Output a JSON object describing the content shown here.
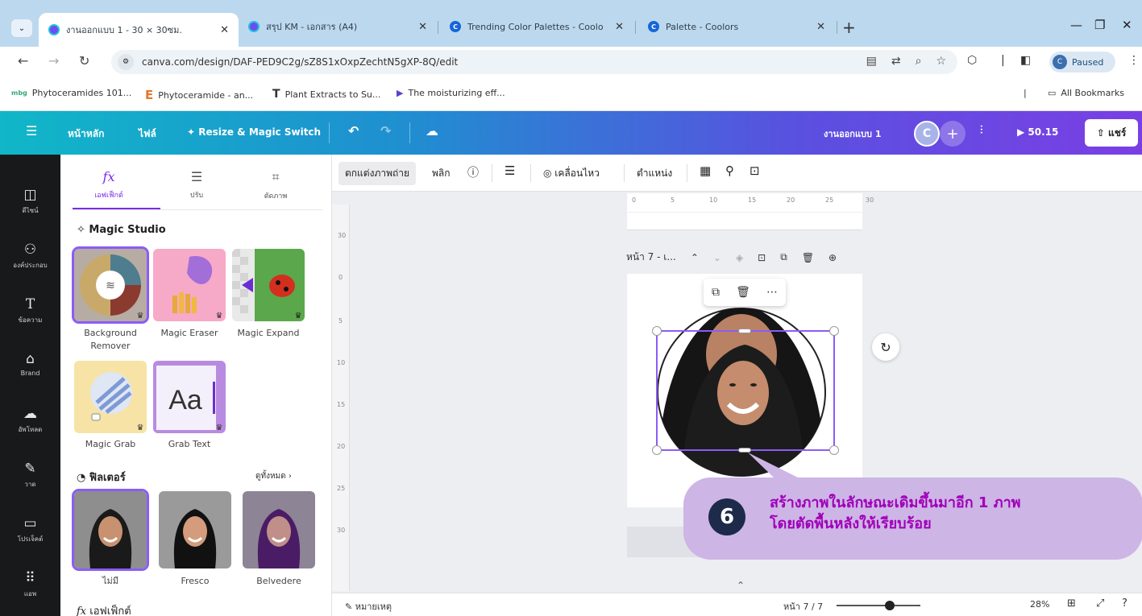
{
  "browser": {
    "tabs": [
      {
        "title": "งานออกแบบ 1 - 30 × 30ซม.",
        "active": true
      },
      {
        "title": "สรุป KM - เอกสาร (A4)",
        "active": false
      },
      {
        "title": "Trending Color Palettes - Coolo",
        "active": false
      },
      {
        "title": "Palette - Coolors",
        "active": false
      }
    ],
    "url": "canva.com/design/DAF-PED9C2g/sZ8S1xOxpZechtN5gXP-8Q/edit",
    "profile_status": "Paused",
    "bookmarks": [
      "Phytoceramides 101...",
      "Phytoceramide - an...",
      "Plant Extracts to Su...",
      "The moisturizing eff..."
    ],
    "all_bookmarks": "All Bookmarks"
  },
  "canva_header": {
    "home": "หน้าหลัก",
    "file": "ไฟล์",
    "resize": "Resize & Magic Switch",
    "doc_title": "งานออกแบบ 1",
    "user_initial": "C",
    "present_time": "50.15",
    "share": "แชร์"
  },
  "rail": [
    {
      "icon": "template-icon",
      "label": "ดีไซน์"
    },
    {
      "icon": "elements-icon",
      "label": "องค์ประกอบ"
    },
    {
      "icon": "text-icon",
      "label": "ข้อความ"
    },
    {
      "icon": "brand-icon",
      "label": "Brand"
    },
    {
      "icon": "upload-icon",
      "label": "อัพโหลด"
    },
    {
      "icon": "draw-icon",
      "label": "วาด"
    },
    {
      "icon": "projects-icon",
      "label": "โปรเจ็คต์"
    },
    {
      "icon": "apps-icon",
      "label": "แอพ"
    }
  ],
  "panel": {
    "tabs": [
      {
        "label": "เอฟเฟ็กต์",
        "icon": "fx"
      },
      {
        "label": "ปรับ",
        "icon": "adjust-icon"
      },
      {
        "label": "ตัดภาพ",
        "icon": "crop-icon"
      }
    ],
    "magic_studio_title": "Magic Studio",
    "magic_tools": [
      {
        "label": "Background Remover"
      },
      {
        "label": "Magic Eraser"
      },
      {
        "label": "Magic Expand"
      },
      {
        "label": "Magic Grab"
      },
      {
        "label": "Grab Text"
      }
    ],
    "filters_title": "ฟิลเตอร์",
    "see_all": "ดูทั้งหมด",
    "filters": [
      {
        "label": "ไม่มี"
      },
      {
        "label": "Fresco"
      },
      {
        "label": "Belvedere"
      }
    ],
    "effects_title": "เอฟเฟ็กต์",
    "grab_text_sample": "Aa"
  },
  "toolbar": {
    "edit_photo": "ตกแต่งภาพถ่าย",
    "flip": "พลิก",
    "animate": "เคลื่อนไหว",
    "position": "ตำแหน่ง"
  },
  "ruler": {
    "top": [
      "0",
      "5",
      "10",
      "15",
      "20",
      "25",
      "30"
    ],
    "left": [
      "30",
      "0",
      "5",
      "10",
      "15",
      "20",
      "25",
      "30"
    ]
  },
  "page_label": "หน้า 7 - เ...",
  "notes_label": "หมายเหตุ",
  "page_counter": "หน้า 7 / 7",
  "zoom": "28%",
  "callout": {
    "number": "6",
    "line1": "สร้างภาพในลักษณะเดิมขึ้นมาอีก 1 ภาพ",
    "line2": "โดยตัดพื้นหลังให้เรียบร้อย"
  }
}
